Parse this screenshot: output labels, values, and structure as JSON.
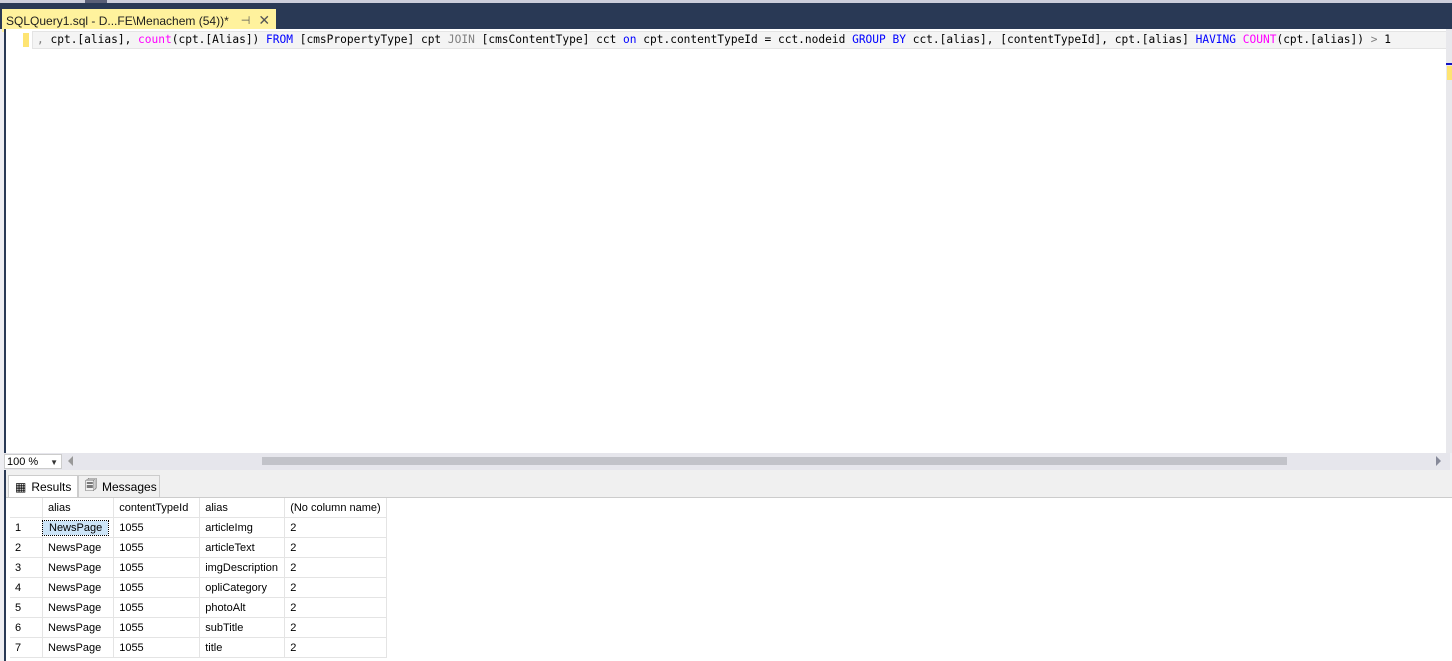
{
  "document_tab": {
    "title": "SQLQuery1.sql - D...FE\\Menachem (54))*",
    "pin_icon": "pin-icon",
    "close_icon": "close-icon"
  },
  "editor": {
    "line_prefix": ",",
    "tokens": [
      {
        "t": " cpt.[alias], ",
        "c": ""
      },
      {
        "t": "count",
        "c": "fn"
      },
      {
        "t": "(cpt.[Alias]) ",
        "c": ""
      },
      {
        "t": "FROM",
        "c": "kw"
      },
      {
        "t": " [cmsPropertyType] cpt ",
        "c": ""
      },
      {
        "t": "JOIN",
        "c": "gr"
      },
      {
        "t": " [cmsContentType] cct ",
        "c": ""
      },
      {
        "t": "on",
        "c": "kw"
      },
      {
        "t": " cpt.contentTypeId = cct.nodeid ",
        "c": ""
      },
      {
        "t": "GROUP BY",
        "c": "kw"
      },
      {
        "t": " cct.[alias], [contentTypeId], cpt.[alias] ",
        "c": ""
      },
      {
        "t": "HAVING",
        "c": "kw"
      },
      {
        "t": " ",
        "c": ""
      },
      {
        "t": "COUNT",
        "c": "fn"
      },
      {
        "t": "(cpt.[alias]) ",
        "c": ""
      },
      {
        "t": ">",
        "c": "gr"
      },
      {
        "t": " 1",
        "c": ""
      }
    ]
  },
  "zoom": {
    "value": "100 %"
  },
  "results": {
    "tabs": [
      {
        "label": "Results",
        "icon": "grid-icon"
      },
      {
        "label": "Messages",
        "icon": "messages-icon"
      }
    ],
    "columns": [
      "alias",
      "contentTypeId",
      "alias",
      "(No column name)"
    ],
    "rows": [
      [
        "1",
        "NewsPage",
        "1055",
        "articleImg",
        "2"
      ],
      [
        "2",
        "NewsPage",
        "1055",
        "articleText",
        "2"
      ],
      [
        "3",
        "NewsPage",
        "1055",
        "imgDescription",
        "2"
      ],
      [
        "4",
        "NewsPage",
        "1055",
        "opliCategory",
        "2"
      ],
      [
        "5",
        "NewsPage",
        "1055",
        "photoAlt",
        "2"
      ],
      [
        "6",
        "NewsPage",
        "1055",
        "subTitle",
        "2"
      ],
      [
        "7",
        "NewsPage",
        "1055",
        "title",
        "2"
      ]
    ]
  }
}
